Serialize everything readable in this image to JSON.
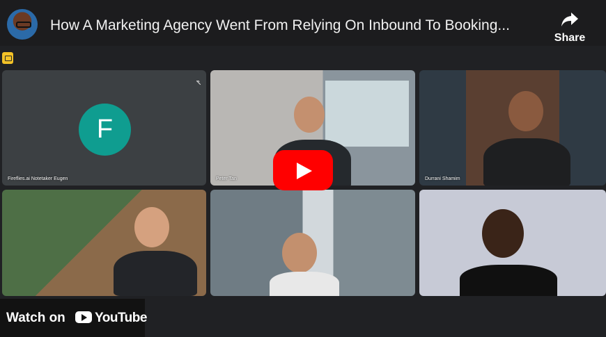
{
  "header": {
    "title": "How A Marketing Agency Went From Relying On Inbound To Booking...",
    "share_label": "Share",
    "avatar_icon": "channel-avatar-icon",
    "share_icon": "share-arrow-icon"
  },
  "call": {
    "badge_icon": "recording-badge-icon",
    "participants": [
      {
        "name": "Fireflies.ai Notetaker Eugen",
        "initial": "F",
        "avatar_color": "#0f9d90"
      },
      {
        "name": "Peter Tan"
      },
      {
        "name": "Durrani Shamim"
      },
      {
        "name": ""
      },
      {
        "name": ""
      },
      {
        "name": ""
      }
    ]
  },
  "player": {
    "play_icon": "play-icon",
    "watch_on": "Watch on",
    "youtube": "YouTube",
    "brand_color": "#ff0000"
  }
}
